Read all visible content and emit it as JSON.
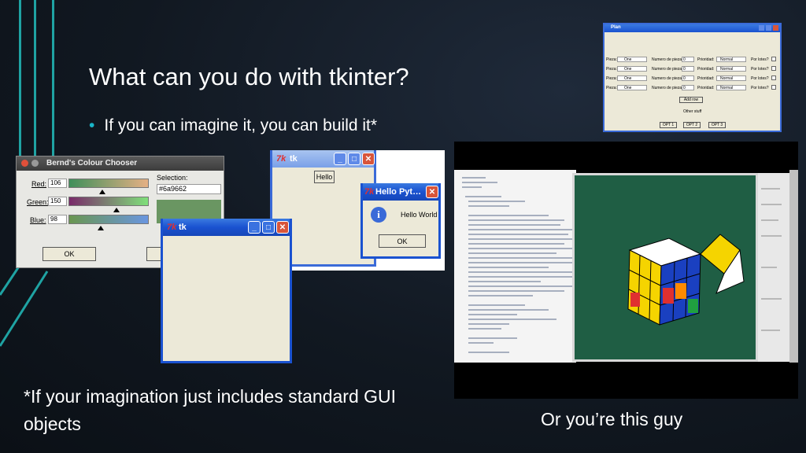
{
  "slide": {
    "title": "What can you do with tkinter?",
    "bullet": "If you can imagine it, you can build it*",
    "footnote": "*If your imagination just includes standard GUI objects",
    "caption": "Or you’re this guy"
  },
  "colour_chooser": {
    "title": "Bernd's Colour Chooser",
    "red_label": "Red:",
    "red_value": "106",
    "green_label": "Green:",
    "green_value": "150",
    "blue_label": "Blue:",
    "blue_value": "98",
    "selection_label": "Selection:",
    "selection_value": "#6a9662",
    "ok_label": "OK"
  },
  "tk_window_small": {
    "title": "tk",
    "button": "Hello"
  },
  "tk_window_large": {
    "title": "tk"
  },
  "message_box": {
    "title": "Hello Pyt…",
    "message": "Hello World",
    "ok_label": "OK"
  },
  "plan_window": {
    "title": "Plan",
    "rows": [
      {
        "pieza": "Pieza:",
        "pieza_val": "One",
        "numero": "Numero de piezas:",
        "numero_val": "0",
        "prioridad": "Prioridad:",
        "prioridad_val": "Normal",
        "por_lotes": "Por lotes?"
      },
      {
        "pieza": "Pieza:",
        "pieza_val": "One",
        "numero": "Numero de piezas:",
        "numero_val": "0",
        "prioridad": "Prioridad:",
        "prioridad_val": "Normal",
        "por_lotes": "Por lotes?"
      },
      {
        "pieza": "Pieza:",
        "pieza_val": "One",
        "numero": "Numero de piezas:",
        "numero_val": "0",
        "prioridad": "Prioridad:",
        "prioridad_val": "Normal",
        "por_lotes": "Por lotes?"
      },
      {
        "pieza": "Pieza:",
        "pieza_val": "One",
        "numero": "Numero de piezas:",
        "numero_val": "0",
        "prioridad": "Prioridad:",
        "prioridad_val": "Normal",
        "por_lotes": "Por lotes?"
      }
    ],
    "add_row": "Add row",
    "other_stuff": "Other stuff",
    "opt_buttons": [
      "OPT 1",
      "OPT 2",
      "OPT 3"
    ]
  },
  "colors": {
    "accent": "#19b5c8",
    "teal_lines": "#1fa3a3",
    "swatch": "#6a9662",
    "felt": "#1f5e44"
  }
}
